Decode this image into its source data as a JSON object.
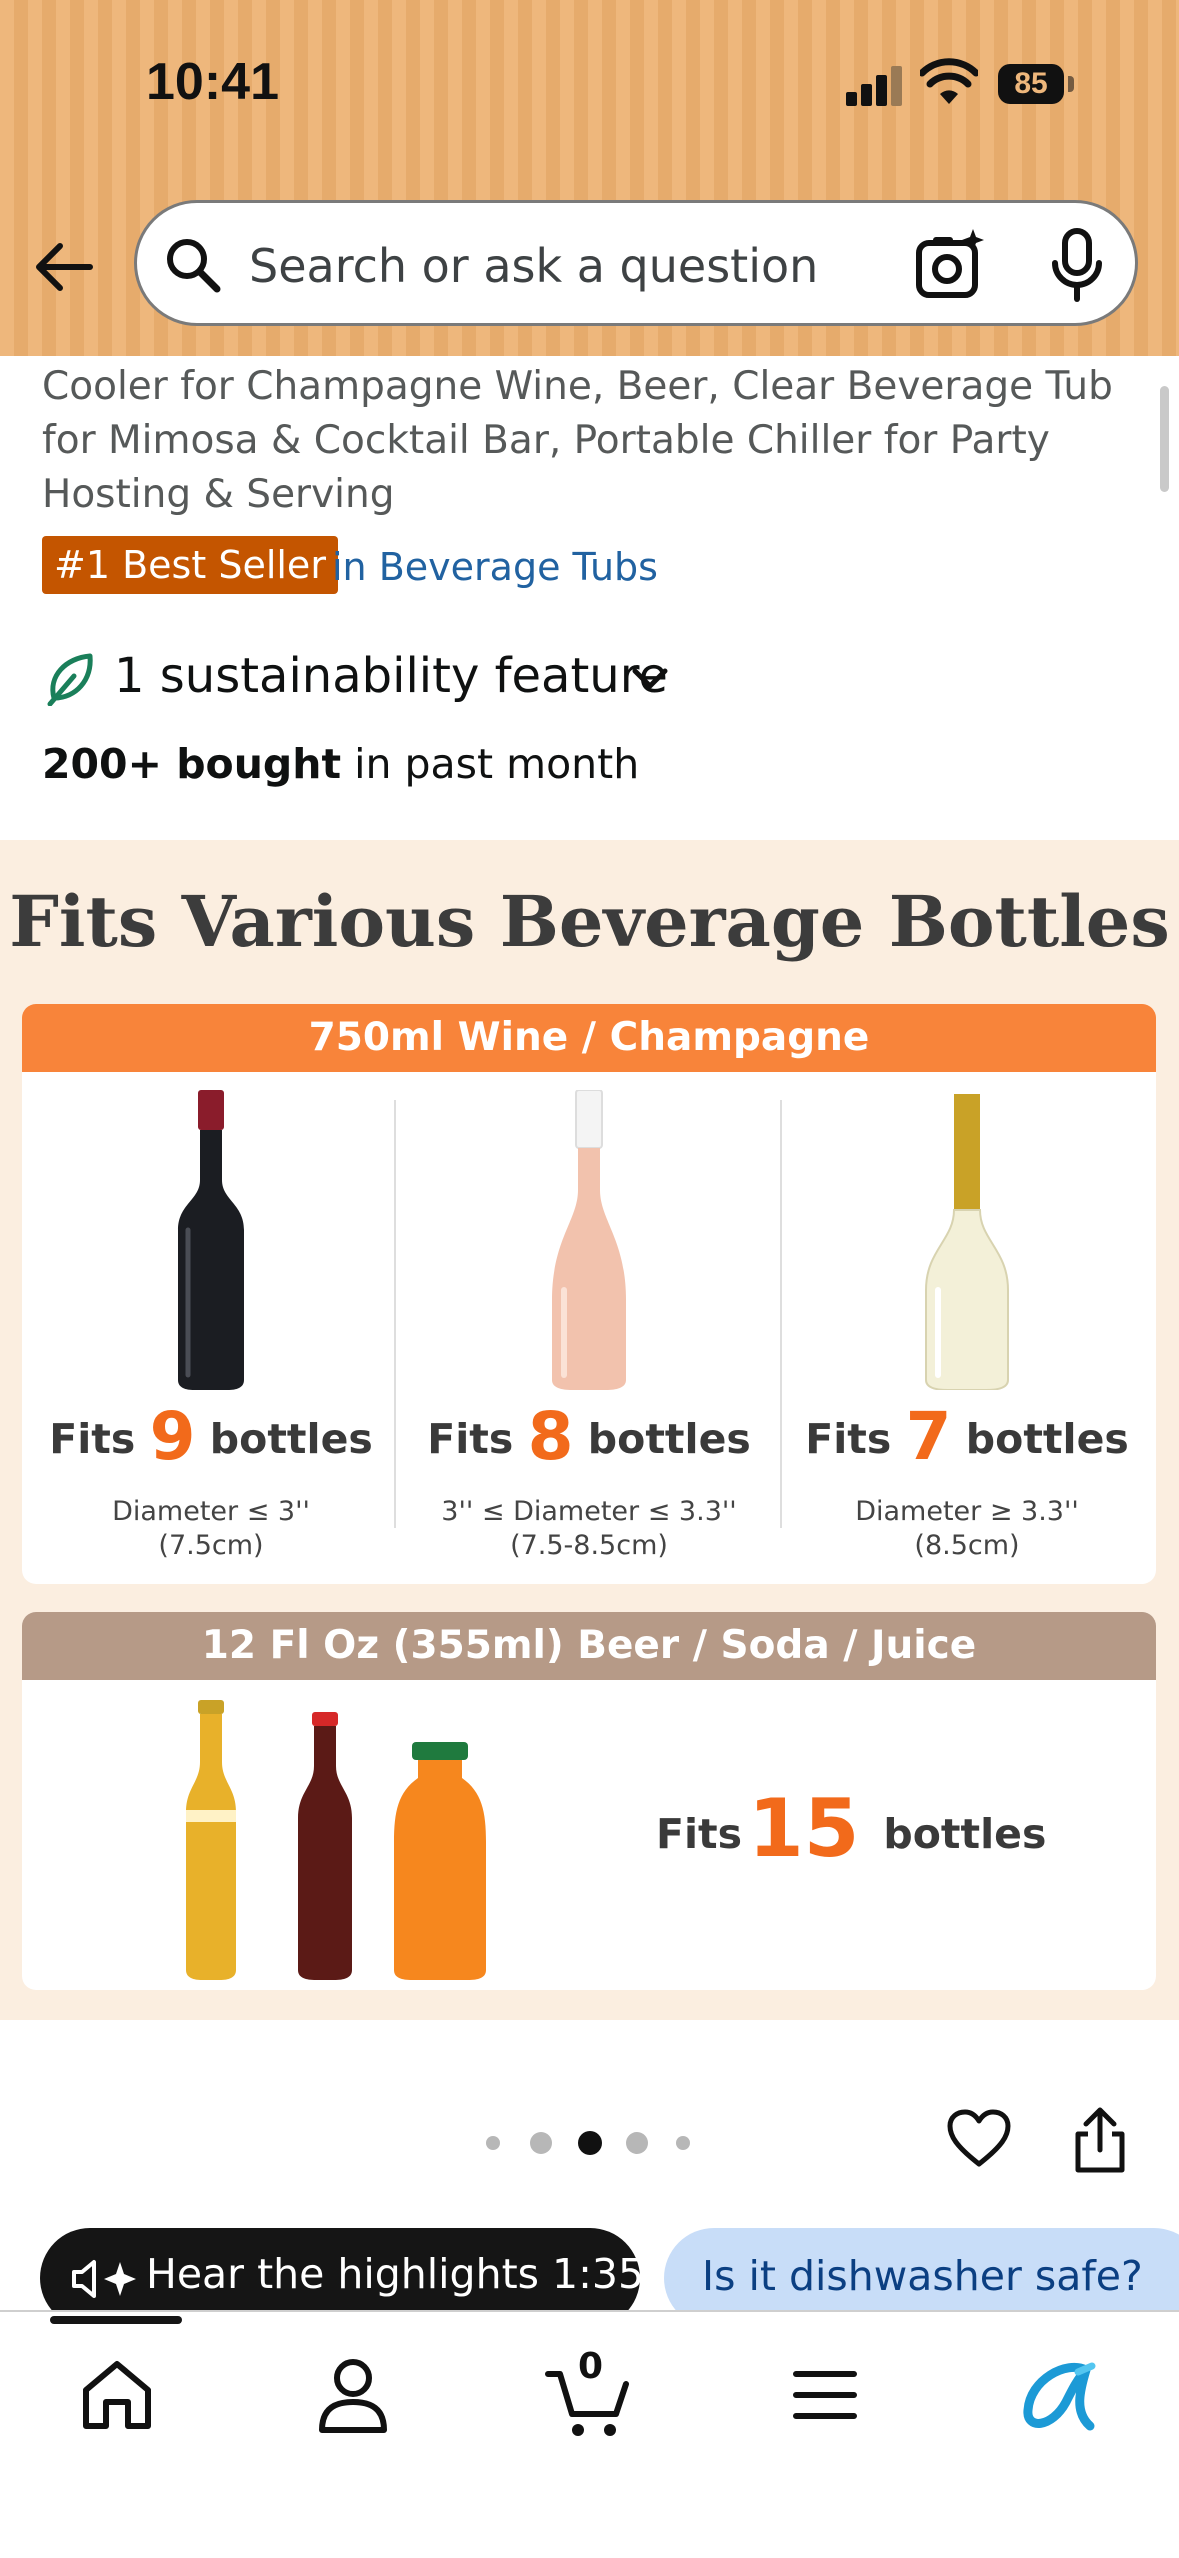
{
  "status_bar": {
    "time": "10:41",
    "battery": "85"
  },
  "search": {
    "placeholder": "Search or ask a question"
  },
  "product": {
    "title_visible": "Cooler for Champagne Wine, Beer, Clear Beverage Tub for Mimosa & Cocktail Bar, Portable Chiller for Party Hosting & Serving",
    "best_seller_badge": "#1 Best Seller",
    "best_seller_category": "in Beverage Tubs",
    "sustainability": "1 sustainability feature",
    "bought_bold": "200+ bought",
    "bought_rest": " in past month"
  },
  "infographic": {
    "title": "Fits Various Beverage Bottles",
    "wine_header": "750ml Wine / Champagne",
    "wine_columns": [
      {
        "fits_word": "Fits",
        "count": "9",
        "unit": "bottles",
        "diameter": "Diameter ≤ 3''",
        "metric": "(7.5cm)",
        "bottle": "red-wine"
      },
      {
        "fits_word": "Fits",
        "count": "8",
        "unit": "bottles",
        "diameter": "3'' ≤ Diameter ≤ 3.3''",
        "metric": "(7.5-8.5cm)",
        "bottle": "rose-wine"
      },
      {
        "fits_word": "Fits",
        "count": "7",
        "unit": "bottles",
        "diameter": "Diameter ≥ 3.3''",
        "metric": "(8.5cm)",
        "bottle": "champagne"
      }
    ],
    "beer_header": "12 Fl Oz (355ml) Beer / Soda / Juice",
    "beer_fits_word": "Fits",
    "beer_count": "15",
    "beer_unit": "bottles"
  },
  "carousel": {
    "dot_count": 5,
    "active_dot": 2
  },
  "chips": {
    "hear": "Hear the highlights 1:35",
    "ask": "Is it dishwasher safe?"
  },
  "nav": {
    "items": [
      "home-icon",
      "account-icon",
      "cart-icon",
      "menu-icon",
      "rufus-icon"
    ],
    "cart_count": "0"
  },
  "colors": {
    "header_orange": "#eeb77c",
    "accent_orange": "#f26a1b",
    "badge_orange": "#c45500",
    "link_blue": "#2162a1",
    "ask_pill": "#c8ddf8"
  }
}
